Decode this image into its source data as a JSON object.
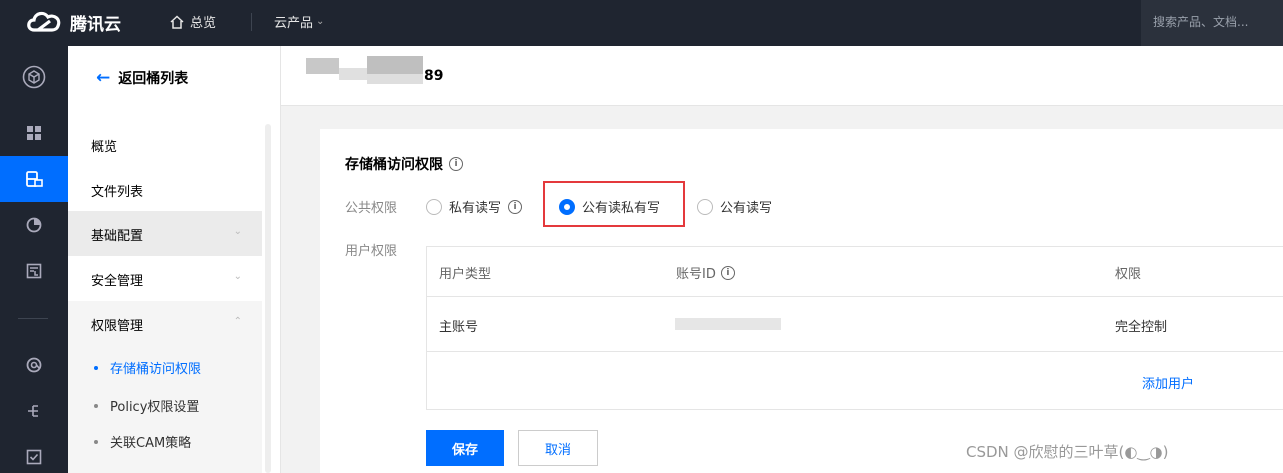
{
  "topbar": {
    "brand": "腾讯云",
    "home_label": "总览",
    "products_label": "云产品",
    "search_placeholder": "搜索产品、文档..."
  },
  "rail": {
    "icons": [
      "cube-icon",
      "grid-icon",
      "storage-icon",
      "pie-icon",
      "image-icon",
      "at-icon",
      "tree-icon",
      "check-icon"
    ],
    "active": "storage-icon"
  },
  "sidebar": {
    "back_label": "返回桶列表",
    "items": [
      {
        "label": "概览"
      },
      {
        "label": "文件列表"
      },
      {
        "label": "基础配置"
      },
      {
        "label": "安全管理"
      },
      {
        "label": "权限管理"
      }
    ],
    "sub_items": [
      {
        "label": "存储桶访问权限",
        "active": true
      },
      {
        "label": "Policy权限设置"
      },
      {
        "label": "关联CAM策略"
      }
    ]
  },
  "header": {
    "bucket_suffix": "89"
  },
  "card": {
    "title": "存储桶访问权限",
    "public_perm_label": "公共权限",
    "options": [
      {
        "label": "私有读写",
        "checked": false
      },
      {
        "label": "公有读私有写",
        "checked": true
      },
      {
        "label": "公有读写",
        "checked": false
      }
    ],
    "user_perm_label": "用户权限",
    "table": {
      "headers": [
        "用户类型",
        "账号ID",
        "权限"
      ],
      "rows": [
        {
          "type": "主账号",
          "perm": "完全控制"
        }
      ],
      "add_user": "添加用户"
    },
    "save_label": "保存",
    "cancel_label": "取消"
  },
  "watermark": "CSDN @欣慰的三叶草(◐‿◑)",
  "colors": {
    "primary": "#006eff",
    "topbar": "#1f2530",
    "highlight": "#e4393c"
  }
}
